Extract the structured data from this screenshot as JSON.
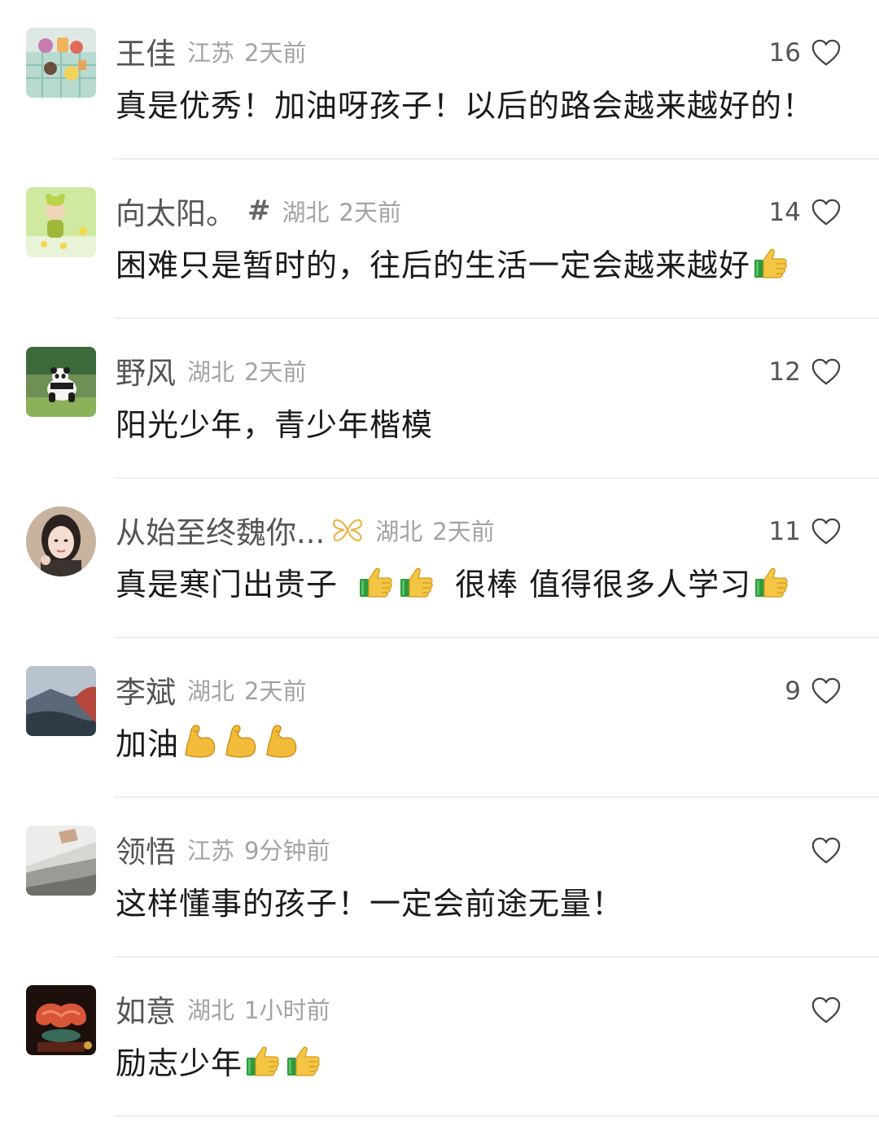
{
  "comments": [
    {
      "name": "王佳",
      "location": "江苏",
      "time": "2天前",
      "likes": "16",
      "text": "真是优秀！加油呀孩子！以后的路会越来越好的！"
    },
    {
      "name": "向太阳。",
      "badge": "#",
      "location": "湖北",
      "time": "2天前",
      "likes": "14",
      "text": "困难只是暂时的，往后的生活一定会越来越好",
      "emoji": [
        "thumbs-up-emoji"
      ]
    },
    {
      "name": "野风",
      "location": "湖北",
      "time": "2天前",
      "likes": "12",
      "text": "阳光少年，青少年楷模"
    },
    {
      "name": "从始至终魏你...",
      "badge_icon": "butterfly-badge-icon",
      "location": "湖北",
      "time": "2天前",
      "likes": "11",
      "text_a": "真是寒门出贵子",
      "emoji_a": [
        "thumbs-up-emoji",
        "thumbs-up-emoji"
      ],
      "text_b": "很棒 值得很多人学习",
      "emoji_b": [
        "thumbs-up-emoji"
      ]
    },
    {
      "name": "李斌",
      "location": "湖北",
      "time": "2天前",
      "likes": "9",
      "text": "加油",
      "emoji": [
        "flexed-biceps-emoji",
        "flexed-biceps-emoji",
        "flexed-biceps-emoji"
      ]
    },
    {
      "name": "领悟",
      "location": "江苏",
      "time": "9分钟前",
      "likes": "",
      "text": "这样懂事的孩子！一定会前途无量！"
    },
    {
      "name": "如意",
      "location": "湖北",
      "time": "1小时前",
      "likes": "",
      "text": "励志少年",
      "emoji": [
        "thumbs-up-emoji",
        "thumbs-up-emoji"
      ]
    }
  ],
  "colors": {
    "name": "#555555",
    "meta": "#a3a3a3",
    "text": "#1a1a1a",
    "divider": "#eeeeee",
    "badge": "#e8b84a"
  }
}
